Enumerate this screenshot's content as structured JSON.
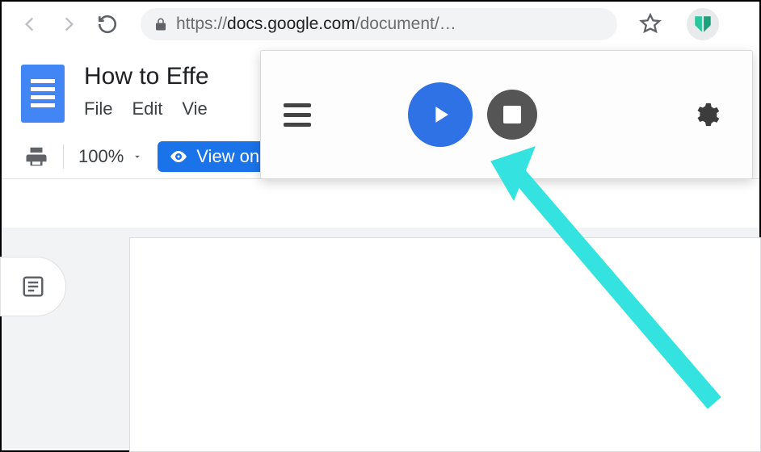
{
  "browser": {
    "url_display_prefix": "https://",
    "url_display_host": "docs.google.com",
    "url_display_path": "/document/…"
  },
  "docs": {
    "title": "How to Effe",
    "menu": {
      "file": "File",
      "edit": "Edit",
      "view": "Vie"
    },
    "toolbar": {
      "zoom": "100%",
      "view_only_label": "View only"
    }
  },
  "extension": {
    "icons": {
      "menu": "menu",
      "play": "play",
      "stop": "stop",
      "settings": "settings"
    }
  },
  "annotation": {
    "arrow_target": "play-button"
  },
  "colors": {
    "accent_blue": "#1a73e8",
    "play_blue": "#2f72e6",
    "cyan": "#34e3e0"
  }
}
